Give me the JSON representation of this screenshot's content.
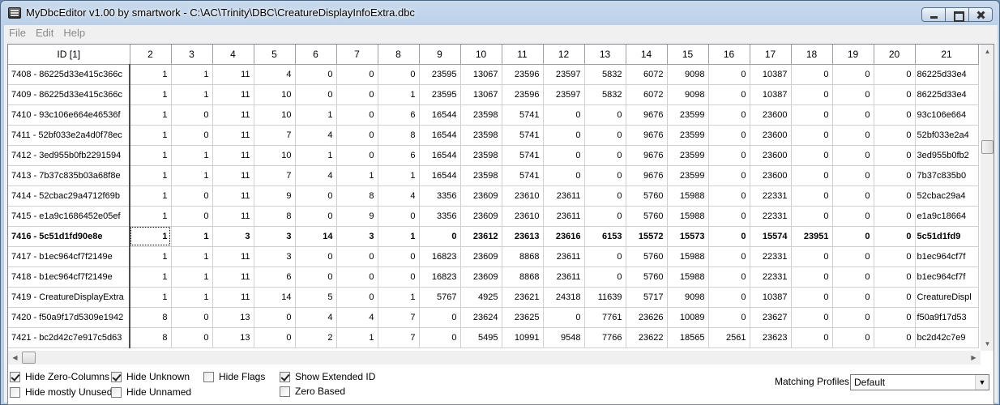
{
  "window": {
    "title": "MyDbcEditor v1.00 by smartwork - C:\\AC\\Trinity\\DBC\\CreatureDisplayInfoExtra.dbc"
  },
  "menu": [
    "File",
    "Edit",
    "Help"
  ],
  "grid": {
    "columns": [
      "ID [1]",
      "2",
      "3",
      "4",
      "5",
      "6",
      "7",
      "8",
      "9",
      "10",
      "11",
      "12",
      "13",
      "14",
      "15",
      "16",
      "17",
      "18",
      "19",
      "20",
      "21"
    ],
    "rows": [
      [
        "7408 - 86225d33e415c366c",
        "1",
        "1",
        "11",
        "4",
        "0",
        "0",
        "0",
        "23595",
        "13067",
        "23596",
        "23597",
        "5832",
        "6072",
        "9098",
        "0",
        "10387",
        "0",
        "0",
        "0",
        "86225d33e4"
      ],
      [
        "7409 - 86225d33e415c366c",
        "1",
        "1",
        "11",
        "10",
        "0",
        "0",
        "1",
        "23595",
        "13067",
        "23596",
        "23597",
        "5832",
        "6072",
        "9098",
        "0",
        "10387",
        "0",
        "0",
        "0",
        "86225d33e4"
      ],
      [
        "7410 - 93c106e664e46536f",
        "1",
        "0",
        "11",
        "10",
        "1",
        "0",
        "6",
        "16544",
        "23598",
        "5741",
        "0",
        "0",
        "9676",
        "23599",
        "0",
        "23600",
        "0",
        "0",
        "0",
        "93c106e664"
      ],
      [
        "7411 - 52bf033e2a4d0f78ec",
        "1",
        "0",
        "11",
        "7",
        "4",
        "0",
        "8",
        "16544",
        "23598",
        "5741",
        "0",
        "0",
        "9676",
        "23599",
        "0",
        "23600",
        "0",
        "0",
        "0",
        "52bf033e2a4"
      ],
      [
        "7412 - 3ed955b0fb2291594",
        "1",
        "1",
        "11",
        "10",
        "1",
        "0",
        "6",
        "16544",
        "23598",
        "5741",
        "0",
        "0",
        "9676",
        "23599",
        "0",
        "23600",
        "0",
        "0",
        "0",
        "3ed955b0fb2"
      ],
      [
        "7413 - 7b37c835b03a68f8e",
        "1",
        "1",
        "11",
        "7",
        "4",
        "1",
        "1",
        "16544",
        "23598",
        "5741",
        "0",
        "0",
        "9676",
        "23599",
        "0",
        "23600",
        "0",
        "0",
        "0",
        "7b37c835b0"
      ],
      [
        "7414 - 52cbac29a4712f69b",
        "1",
        "0",
        "11",
        "9",
        "0",
        "8",
        "4",
        "3356",
        "23609",
        "23610",
        "23611",
        "0",
        "5760",
        "15988",
        "0",
        "22331",
        "0",
        "0",
        "0",
        "52cbac29a4"
      ],
      [
        "7415 - e1a9c1686452e05ef",
        "1",
        "0",
        "11",
        "8",
        "0",
        "9",
        "0",
        "3356",
        "23609",
        "23610",
        "23611",
        "0",
        "5760",
        "15988",
        "0",
        "22331",
        "0",
        "0",
        "0",
        "e1a9c18664"
      ],
      [
        "7416 - 5c51d1fd90e8e",
        "1",
        "1",
        "3",
        "3",
        "14",
        "3",
        "1",
        "0",
        "23612",
        "23613",
        "23616",
        "6153",
        "15572",
        "15573",
        "0",
        "15574",
        "23951",
        "0",
        "0",
        "5c51d1fd9"
      ],
      [
        "7417 - b1ec964cf7f2149e",
        "1",
        "1",
        "11",
        "3",
        "0",
        "0",
        "0",
        "16823",
        "23609",
        "8868",
        "23611",
        "0",
        "5760",
        "15988",
        "0",
        "22331",
        "0",
        "0",
        "0",
        "b1ec964cf7f"
      ],
      [
        "7418 - b1ec964cf7f2149e",
        "1",
        "1",
        "11",
        "6",
        "0",
        "0",
        "0",
        "16823",
        "23609",
        "8868",
        "23611",
        "0",
        "5760",
        "15988",
        "0",
        "22331",
        "0",
        "0",
        "0",
        "b1ec964cf7f"
      ],
      [
        "7419 - CreatureDisplayExtra",
        "1",
        "1",
        "11",
        "14",
        "5",
        "0",
        "1",
        "5767",
        "4925",
        "23621",
        "24318",
        "11639",
        "5717",
        "9098",
        "0",
        "10387",
        "0",
        "0",
        "0",
        "CreatureDispl"
      ],
      [
        "7420 - f50a9f17d5309e1942",
        "8",
        "0",
        "13",
        "0",
        "4",
        "4",
        "7",
        "0",
        "23624",
        "23625",
        "0",
        "7761",
        "23626",
        "10089",
        "0",
        "23627",
        "0",
        "0",
        "0",
        "f50a9f17d53"
      ],
      [
        "7421 - bc2d42c7e917c5d63",
        "8",
        "0",
        "13",
        "0",
        "2",
        "1",
        "7",
        "0",
        "5495",
        "10991",
        "9548",
        "7766",
        "23622",
        "18565",
        "2561",
        "23623",
        "0",
        "0",
        "0",
        "bc2d42c7e9"
      ]
    ]
  },
  "options": {
    "hide_zero_columns": "Hide Zero-Columns",
    "hide_mostly_unused": "Hide mostly Unused",
    "hide_unknown": "Hide Unknown",
    "hide_unnamed": "Hide Unnamed",
    "hide_flags": "Hide Flags",
    "show_extended_id": "Show Extended ID",
    "zero_based": "Zero Based"
  },
  "matching_profiles": {
    "label": "Matching Profiles:",
    "value": "Default"
  }
}
